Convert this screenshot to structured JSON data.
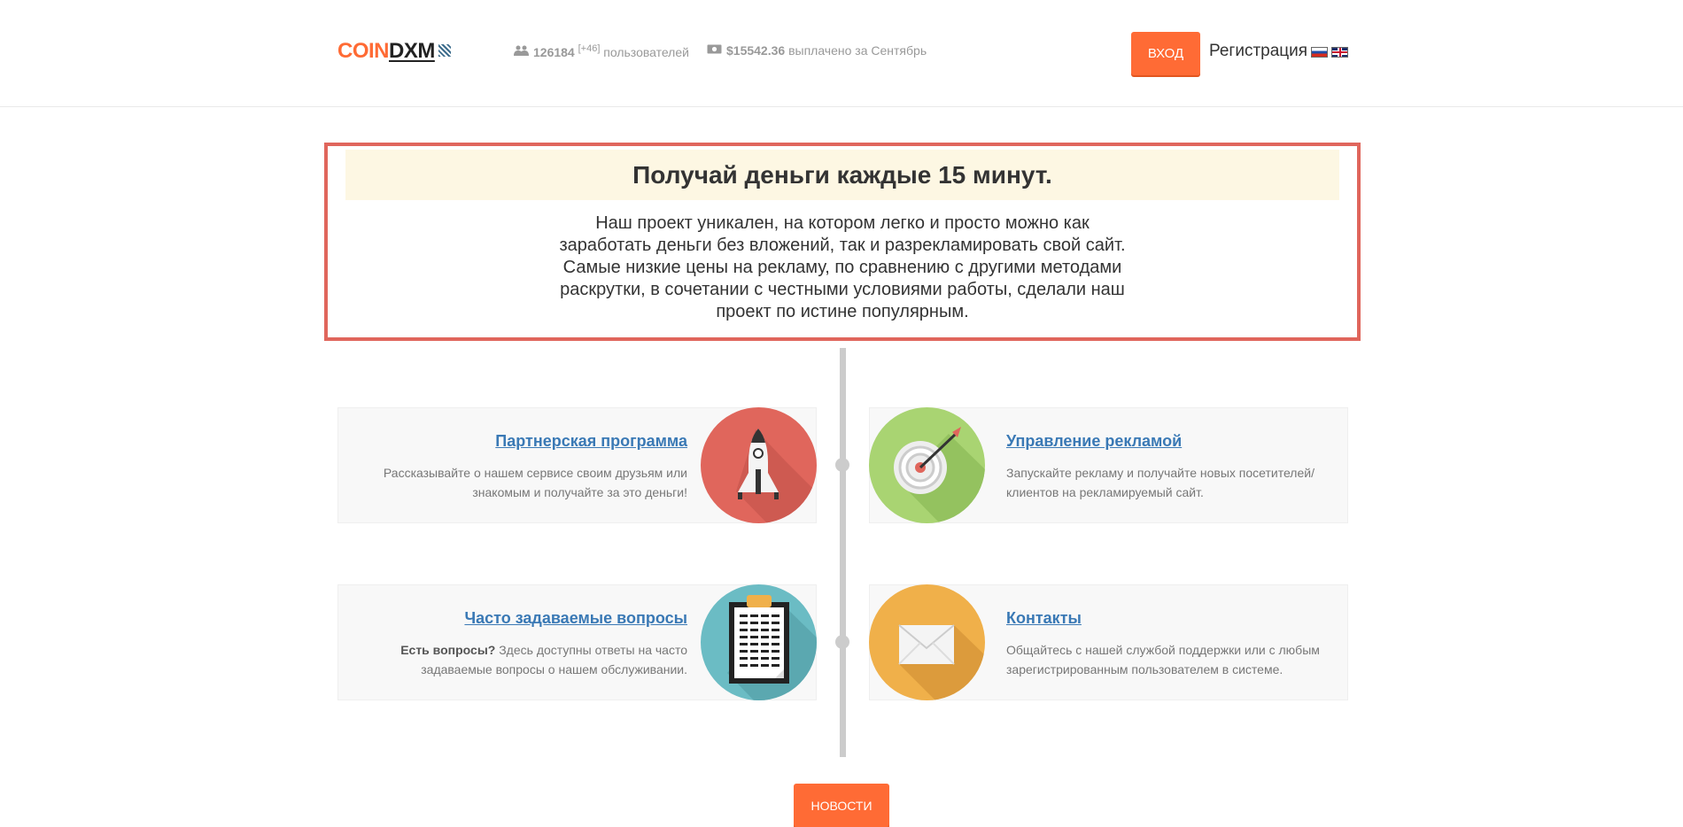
{
  "header": {
    "logo": {
      "part1": "COIN",
      "part2": "DXM"
    },
    "users": {
      "count": "126184",
      "delta": "[+46]",
      "label": "пользователей",
      "icon": "users-icon"
    },
    "paid": {
      "amount": "$15542.36",
      "label": "выплачено за Сентябрь",
      "icon": "money-icon"
    },
    "login_label": "ВХОД",
    "register_label": "Регистрация",
    "languages": [
      "ru-flag",
      "en-flag"
    ]
  },
  "hero": {
    "title": "Получай деньги каждые 15 минут.",
    "lines": [
      "Наш проект уникален, на котором легко и просто можно как",
      "заработать деньги без вложений, так и разрекламировать свой сайт.",
      "Самые низкие цены на рекламу, по сравнению с другими методами",
      "раскрутки, в сочетании с честными условиями работы, сделали наш",
      "проект по истине популярным."
    ]
  },
  "features": {
    "partner": {
      "title": "Партнерская программа",
      "lines": [
        "Рассказывайте о нашем сервисе своим друзьям или",
        "знакомым и получайте за это деньги!"
      ],
      "icon": "rocket-icon",
      "color": "#e0665c"
    },
    "ads": {
      "title": "Управление рекламой",
      "lines": [
        "Запускайте рекламу и получайте новых посетителей/",
        "клиентов на рекламируемый сайт."
      ],
      "icon": "target-icon",
      "color": "#a9d472"
    },
    "faq": {
      "title": "Часто задаваемые вопросы",
      "bold": "Есть вопросы?",
      "line1_rest": " Здесь доступны ответы на часто",
      "line2": "задаваемые вопросы о нашем обслуживании.",
      "icon": "clipboard-icon",
      "color": "#6bbcc4"
    },
    "contacts": {
      "title": "Контакты",
      "lines": [
        "Общайтесь с нашей службой поддержки или с любым",
        "зарегистрированным пользователем в системе."
      ],
      "icon": "envelope-icon",
      "color": "#f0b04a"
    }
  },
  "news_label": "НОВОСТИ",
  "colors": {
    "accent": "#ff6b35",
    "hero_border": "#e0665c",
    "link": "#3a79b5"
  }
}
